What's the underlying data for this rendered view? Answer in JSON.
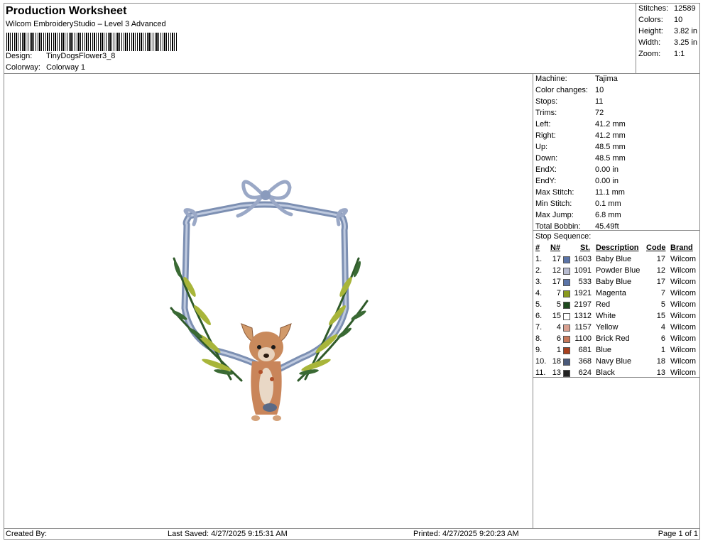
{
  "header": {
    "title": "Production Worksheet",
    "subtitle": "Wilcom EmbroideryStudio – Level 3 Advanced",
    "design_label": "Design:",
    "design_value": "TinyDogsFlower3_8",
    "colorway_label": "Colorway:",
    "colorway_value": "Colorway 1"
  },
  "top_stats": [
    {
      "k": "Stitches:",
      "v": "12589"
    },
    {
      "k": "Colors:",
      "v": "10"
    },
    {
      "k": "Height:",
      "v": "3.82 in"
    },
    {
      "k": "Width:",
      "v": "3.25 in"
    },
    {
      "k": "Zoom:",
      "v": "1:1"
    }
  ],
  "machine_info": [
    {
      "k": "Machine:",
      "v": "Tajima"
    },
    {
      "k": "Color changes:",
      "v": "10"
    },
    {
      "k": "Stops:",
      "v": "11"
    },
    {
      "k": "Trims:",
      "v": "72"
    },
    {
      "k": "Left:",
      "v": "41.2 mm"
    },
    {
      "k": "Right:",
      "v": "41.2 mm"
    },
    {
      "k": "Up:",
      "v": "48.5 mm"
    },
    {
      "k": "Down:",
      "v": "48.5 mm"
    },
    {
      "k": "EndX:",
      "v": "0.00 in"
    },
    {
      "k": "EndY:",
      "v": "0.00 in"
    },
    {
      "k": "Max Stitch:",
      "v": "11.1 mm"
    },
    {
      "k": "Min Stitch:",
      "v": "0.1 mm"
    },
    {
      "k": "Max Jump:",
      "v": "6.8 mm"
    },
    {
      "k": "Total Bobbin:",
      "v": "45.49ft"
    }
  ],
  "stop_sequence": {
    "title": "Stop Sequence:",
    "headers": {
      "num": "#",
      "n": "N#",
      "st": "St.",
      "desc": "Description",
      "code": "Code",
      "brand": "Brand"
    },
    "rows": [
      {
        "num": "1.",
        "n": "17",
        "color": "#5b74a8",
        "st": "1603",
        "desc": "Baby Blue",
        "code": "17",
        "brand": "Wilcom"
      },
      {
        "num": "2.",
        "n": "12",
        "color": "#b8bcd0",
        "st": "1091",
        "desc": "Powder Blue",
        "code": "12",
        "brand": "Wilcom"
      },
      {
        "num": "3.",
        "n": "17",
        "color": "#5b74a8",
        "st": "533",
        "desc": "Baby Blue",
        "code": "17",
        "brand": "Wilcom"
      },
      {
        "num": "4.",
        "n": "7",
        "color": "#8a9a1e",
        "st": "1921",
        "desc": "Magenta",
        "code": "7",
        "brand": "Wilcom"
      },
      {
        "num": "5.",
        "n": "5",
        "color": "#1e4a1e",
        "st": "2197",
        "desc": "Red",
        "code": "5",
        "brand": "Wilcom"
      },
      {
        "num": "6.",
        "n": "15",
        "color": "#ffffff",
        "st": "1312",
        "desc": "White",
        "code": "15",
        "brand": "Wilcom"
      },
      {
        "num": "7.",
        "n": "4",
        "color": "#d9a090",
        "st": "1157",
        "desc": "Yellow",
        "code": "4",
        "brand": "Wilcom"
      },
      {
        "num": "8.",
        "n": "6",
        "color": "#c8785a",
        "st": "1100",
        "desc": "Brick Red",
        "code": "6",
        "brand": "Wilcom"
      },
      {
        "num": "9.",
        "n": "1",
        "color": "#a8401e",
        "st": "681",
        "desc": "Blue",
        "code": "1",
        "brand": "Wilcom"
      },
      {
        "num": "10.",
        "n": "18",
        "color": "#4a5a7a",
        "st": "368",
        "desc": "Navy Blue",
        "code": "18",
        "brand": "Wilcom"
      },
      {
        "num": "11.",
        "n": "13",
        "color": "#222222",
        "st": "624",
        "desc": "Black",
        "code": "13",
        "brand": "Wilcom"
      }
    ]
  },
  "footer": {
    "created": "Created By:",
    "saved": "Last Saved: 4/27/2025 9:15:31 AM",
    "printed": "Printed: 4/27/2025 9:20:23 AM",
    "page": "Page 1 of 1"
  }
}
